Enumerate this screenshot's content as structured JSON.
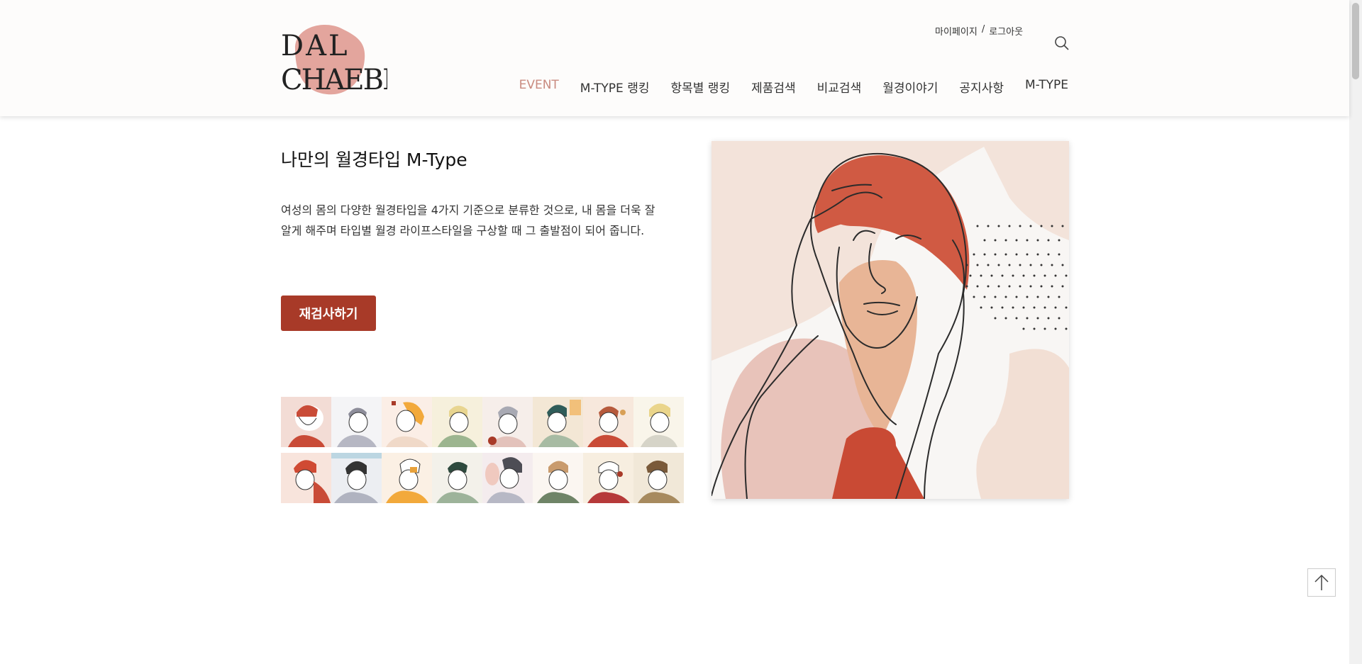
{
  "logo": {
    "line1": "DAL",
    "line2": "CHAEBI"
  },
  "util": {
    "mypage": "마이페이지",
    "sep": "/",
    "logout": "로그아웃"
  },
  "nav": [
    "EVENT",
    "M-TYPE 랭킹",
    "항목별 랭킹",
    "제품검색",
    "비교검색",
    "월경이야기",
    "공지사항",
    "M-TYPE"
  ],
  "main": {
    "title": "나만의 월경타입 M-Type",
    "desc_line1": "여성의 몸의 다양한 월경타입을 4가지 기준으로 분류한 것으로, 내 몸을 더욱 잘",
    "desc_line2": "알게 해주며 타입별 월경 라이프스타일을 구상할 때 그 출발점이 되어 줍니다.",
    "retest_label": "재검사하기"
  },
  "colors": {
    "accent": "#a83a28",
    "nav_active": "#c98b80",
    "logo_blob": "#e3a59d"
  },
  "icons": {
    "search": "search-icon",
    "top": "arrow-up-icon"
  }
}
